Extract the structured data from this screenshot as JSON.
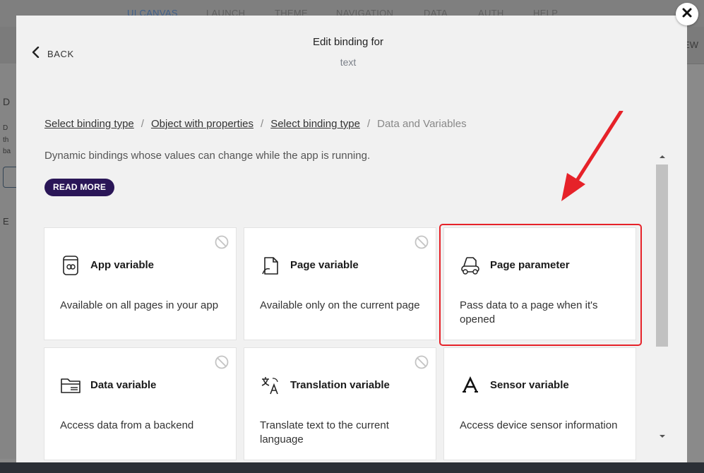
{
  "background": {
    "nav_items": [
      "UI CANVAS",
      "LAUNCH",
      "THEME",
      "NAVIGATION",
      "DATA",
      "AUTH",
      "HELP"
    ],
    "right_fragment": "EW",
    "left_fragments": [
      "D",
      "D",
      "th",
      "ba",
      "E"
    ]
  },
  "modal": {
    "back_label": "BACK",
    "title": "Edit binding for",
    "subtitle": "text",
    "breadcrumb": {
      "links": [
        "Select binding type",
        "Object with properties",
        "Select binding type"
      ],
      "separator": "/",
      "current": "Data and Variables"
    },
    "description": "Dynamic bindings whose values can change while the app is running.",
    "read_more_label": "READ MORE",
    "cards": [
      {
        "icon": "app-variable-icon",
        "title": "App variable",
        "description": "Available on all pages in your app",
        "disabled": true
      },
      {
        "icon": "page-variable-icon",
        "title": "Page variable",
        "description": "Available only on the current page",
        "disabled": true
      },
      {
        "icon": "page-parameter-icon",
        "title": "Page parameter",
        "description": "Pass data to a page when it's opened",
        "disabled": false,
        "highlighted": true
      },
      {
        "icon": "data-variable-icon",
        "title": "Data variable",
        "description": "Access data from a backend",
        "disabled": true
      },
      {
        "icon": "translation-variable-icon",
        "title": "Translation variable",
        "description": "Translate text to the current language",
        "disabled": true
      },
      {
        "icon": "sensor-variable-icon",
        "title": "Sensor variable",
        "description": "Access device sensor information",
        "disabled": false
      }
    ]
  },
  "colors": {
    "accent_dark": "#2a1657",
    "highlight_red": "#e62229",
    "modal_bg": "#f1f1f1"
  }
}
